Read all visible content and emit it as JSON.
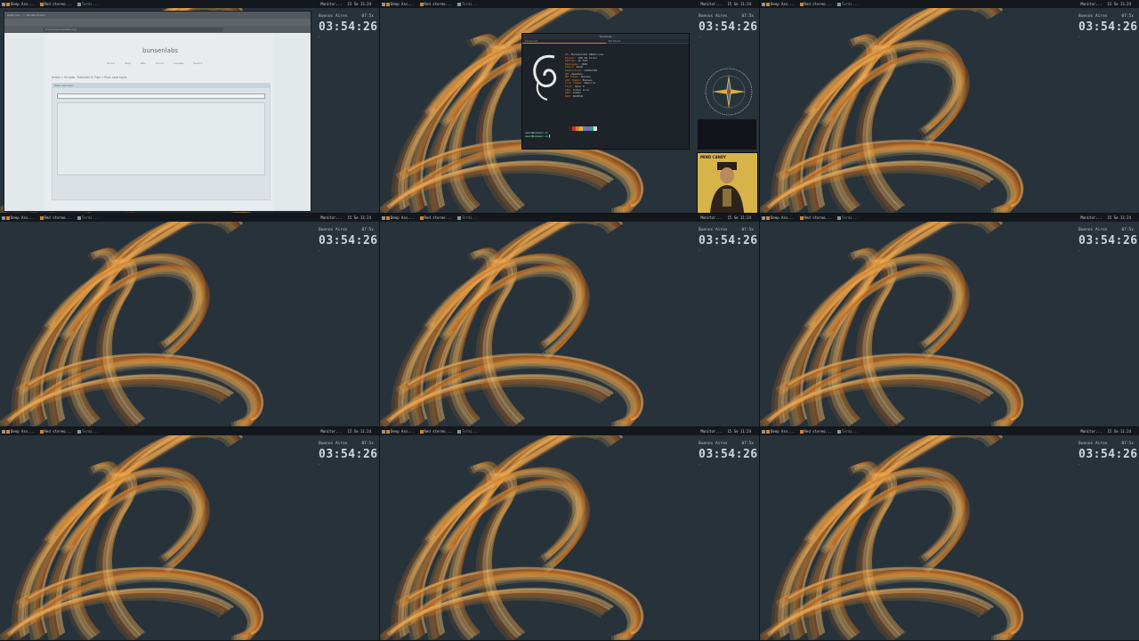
{
  "desktop": {
    "workspaces": [
      {
        "id": 1,
        "panel_left_tasks": [
          "Deep Ass...",
          "Red stereo...",
          "Termi..."
        ],
        "panel_right": "Monitor...",
        "clock_short": "15 Se 11:24",
        "window": "browser"
      },
      {
        "id": 2,
        "panel_left_tasks": [
          "Deep Ass...",
          "Red stereo...",
          "Termi..."
        ],
        "panel_right": "Monitor...",
        "clock_short": "15 Se 11:24",
        "window": "terminal"
      },
      {
        "id": 3,
        "panel_left_tasks": [
          "Deep Ass...",
          "Red stereo...",
          "Termi..."
        ],
        "panel_right": "Monitor...",
        "clock_short": "15 Se 11:24",
        "window": "none"
      },
      {
        "id": 4,
        "panel_left_tasks": [
          "Deep Ass...",
          "Red stereo...",
          "Termi..."
        ],
        "panel_right": "Monitor...",
        "clock_short": "15 Se 11:24",
        "window": "none"
      },
      {
        "id": 5,
        "panel_left_tasks": [
          "Deep Ass...",
          "Red stereo...",
          "Termi..."
        ],
        "panel_right": "Monitor...",
        "clock_short": "15 Se 11:24",
        "window": "none"
      },
      {
        "id": 6,
        "panel_left_tasks": [
          "Deep Ass...",
          "Red stereo...",
          "Termi..."
        ],
        "panel_right": "Monitor...",
        "clock_short": "15 Se 11:24",
        "window": "none"
      },
      {
        "id": 7,
        "panel_left_tasks": [
          "Deep Ass...",
          "Red stereo...",
          "Termi..."
        ],
        "panel_right": "Monitor...",
        "clock_short": "15 Se 11:24",
        "window": "none"
      },
      {
        "id": 8,
        "panel_left_tasks": [
          "Deep Ass...",
          "Red stereo...",
          "Termi..."
        ],
        "panel_right": "Monitor...",
        "clock_short": "15 Se 11:24",
        "window": "none"
      },
      {
        "id": 9,
        "panel_left_tasks": [
          "Deep Ass...",
          "Red stereo...",
          "Termi..."
        ],
        "panel_right": "Monitor...",
        "clock_short": "15 Se 11:24",
        "window": "none"
      }
    ]
  },
  "conky": {
    "city": "Buenos Aires",
    "time_small": "07:5x",
    "clock": "03:54:26",
    "subline": "…"
  },
  "browser": {
    "title_bar": "Deep Ass... — Mozilla Firefox",
    "url": "forums.bunsenlabs.org",
    "logo_text": "bunsenlabs",
    "nav_items": [
      "Home",
      "Help",
      "Wiki",
      "Forum",
      "Donate",
      "Search"
    ],
    "breadcrumb": "Index » Scripts, Tutorials & Tips » Post new topic",
    "form_header": "Post new topic",
    "form_subject_label": "Subject",
    "form_message_label": "Message"
  },
  "terminal": {
    "title": "Terminal",
    "tab1": "Terminal",
    "tab2": "Terminal",
    "info_lines": [
      {
        "k": "OS:",
        "v": "BunsenLabs GNU/Linux"
      },
      {
        "k": "Kernel:",
        "v": "x86_64 Linux"
      },
      {
        "k": "Uptime:",
        "v": "1h 12m"
      },
      {
        "k": "Packages:",
        "v": "1640"
      },
      {
        "k": "Shell:",
        "v": "bash"
      },
      {
        "k": "Resolution:",
        "v": "1280x720"
      },
      {
        "k": "WM:",
        "v": "Openbox"
      },
      {
        "k": "WM Theme:",
        "v": "Bunsen"
      },
      {
        "k": "GTK Theme:",
        "v": "Bunsen"
      },
      {
        "k": "Icon Theme:",
        "v": "Papirus"
      },
      {
        "k": "Font:",
        "v": "Sans 9"
      },
      {
        "k": "CPU:",
        "v": "Intel Core"
      },
      {
        "k": "GPU:",
        "v": "Intel"
      },
      {
        "k": "RAM:",
        "v": "812MiB"
      }
    ],
    "prompt": "user@bunsen:~$"
  },
  "album": {
    "title": "MIND CANDY"
  },
  "colors": {
    "desktop_bg": "#27323b",
    "panel_bg": "#14181c",
    "accent_orange": "#d9822b",
    "swirl_light": "#f3b860",
    "swirl_dark": "#a8561a"
  }
}
